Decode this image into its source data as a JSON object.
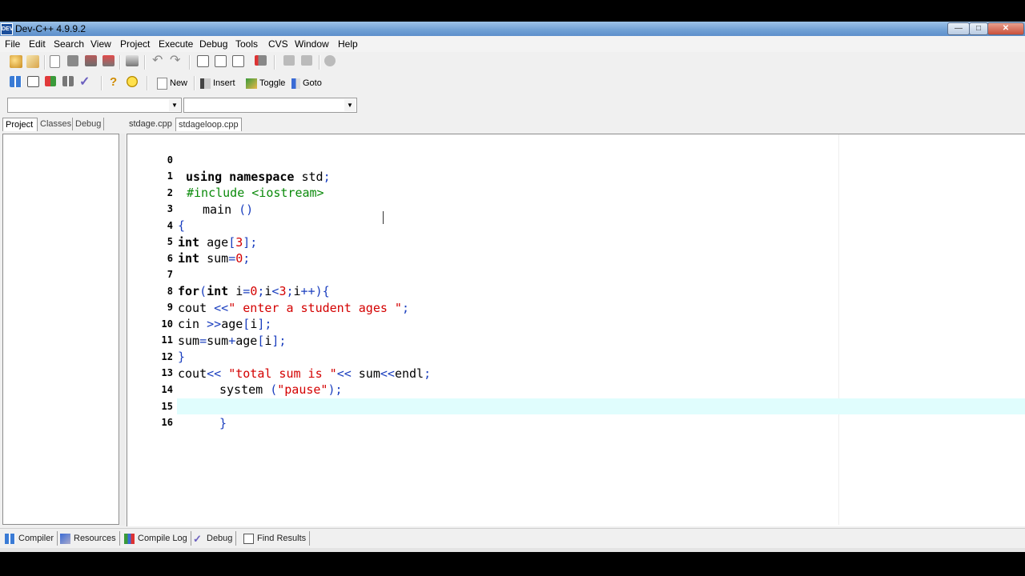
{
  "window": {
    "title": "Dev-C++ 4.9.9.2",
    "app_icon": "dev-cpp-icon"
  },
  "menu": [
    "File",
    "Edit",
    "Search",
    "View",
    "Project",
    "Execute",
    "Debug",
    "Tools",
    "CVS",
    "Window",
    "Help"
  ],
  "toolbar2": {
    "new_label": "New",
    "insert_label": "Insert",
    "toggle_label": "Toggle",
    "goto_label": "Goto"
  },
  "left_tabs": [
    "Project",
    "Classes",
    "Debug"
  ],
  "editor_tabs": [
    "stdage.cpp",
    "stdageloop.cpp"
  ],
  "code_lines": [
    {
      "n": "0",
      "t": "using namespace std;"
    },
    {
      "n": "1",
      "t": "#include <iostream>"
    },
    {
      "n": "2",
      "t": "main ()"
    },
    {
      "n": "3",
      "t": "{"
    },
    {
      "n": "4",
      "t": "int age[3];"
    },
    {
      "n": "5",
      "t": "int sum=0;"
    },
    {
      "n": "6",
      "t": ""
    },
    {
      "n": "7",
      "t": "for(int i=0;i<3;i++){"
    },
    {
      "n": "8",
      "t": "cout <<\" enter a student ages \";"
    },
    {
      "n": "9",
      "t": "cin >>age[i];"
    },
    {
      "n": "10",
      "t": "sum=sum+age[i];"
    },
    {
      "n": "11",
      "t": "}"
    },
    {
      "n": "12",
      "t": "cout<< \"total sum is \"<< sum<<endl;"
    },
    {
      "n": "13",
      "t": "system (\"pause\");"
    },
    {
      "n": "14",
      "t": ""
    },
    {
      "n": "15",
      "t": "}"
    },
    {
      "n": "16",
      "t": ""
    }
  ],
  "bottom_tabs": [
    "Compiler",
    "Resources",
    "Compile Log",
    "Debug",
    "Find Results"
  ],
  "colors": {
    "keyword": "#000000",
    "string": "#d40000",
    "preprocessor": "#0a8a0a",
    "symbol": "#1b3fbf",
    "current_line": "#e0fdfd"
  }
}
